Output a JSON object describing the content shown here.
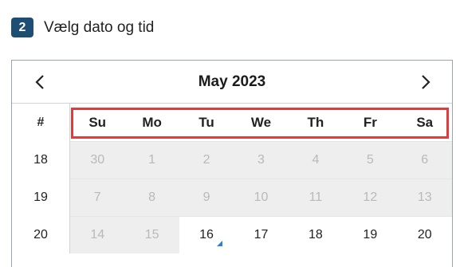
{
  "step": {
    "number": "2",
    "title": "Vælg dato og tid"
  },
  "calendar": {
    "month_label": "May 2023",
    "prev_icon": "chevron-left-icon",
    "next_icon": "chevron-right-icon",
    "week_header": "#",
    "weekdays": [
      "Su",
      "Mo",
      "Tu",
      "We",
      "Th",
      "Fr",
      "Sa"
    ],
    "weeks": [
      {
        "number": "18",
        "days": [
          "30",
          "1",
          "2",
          "3",
          "4",
          "5",
          "6"
        ]
      },
      {
        "number": "19",
        "days": [
          "7",
          "8",
          "9",
          "10",
          "11",
          "12",
          "13"
        ]
      },
      {
        "number": "20",
        "days": [
          "14",
          "15",
          "16",
          "17",
          "18",
          "19",
          "20"
        ]
      }
    ],
    "today": "16"
  },
  "colors": {
    "badge": "#1e4f73",
    "highlight": "#e23b3b",
    "today_marker": "#2f80d1",
    "disabled_bg": "#eeeeee"
  }
}
